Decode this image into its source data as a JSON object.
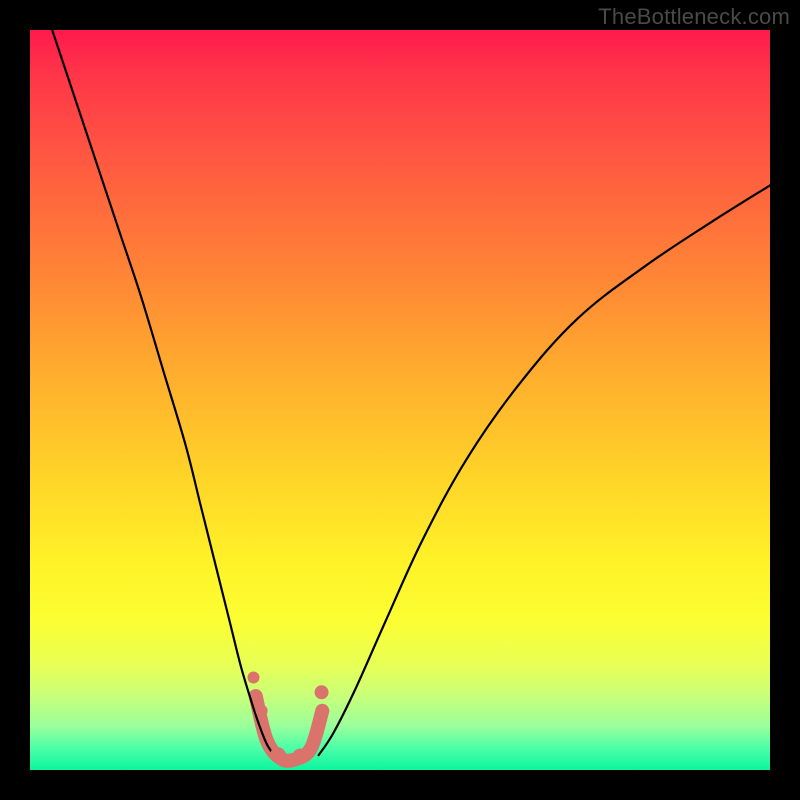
{
  "watermark": {
    "text": "TheBottleneck.com"
  },
  "chart_data": {
    "type": "line",
    "title": "",
    "xlabel": "",
    "ylabel": "",
    "xlim": [
      0,
      100
    ],
    "ylim": [
      0,
      100
    ],
    "grid": false,
    "legend": false,
    "background_gradient": {
      "orientation": "vertical",
      "stops": [
        {
          "pos": 0.0,
          "color": "#ff1a4d"
        },
        {
          "pos": 0.18,
          "color": "#ff5a41"
        },
        {
          "pos": 0.46,
          "color": "#ffac2e"
        },
        {
          "pos": 0.72,
          "color": "#fff228"
        },
        {
          "pos": 0.9,
          "color": "#c8ff7a"
        },
        {
          "pos": 1.0,
          "color": "#0cf59f"
        }
      ]
    },
    "series": [
      {
        "name": "left-arm",
        "color": "#000000",
        "x": [
          3,
          6,
          9,
          12,
          15,
          18,
          21,
          23,
          25,
          27,
          28.5,
          30,
          31,
          32,
          33
        ],
        "y": [
          100,
          91,
          82,
          73,
          64,
          54,
          44,
          36,
          28,
          20,
          14,
          9,
          6,
          3.5,
          2
        ]
      },
      {
        "name": "right-arm",
        "color": "#000000",
        "x": [
          39,
          41,
          44,
          48,
          53,
          59,
          66,
          74,
          83,
          92,
          100
        ],
        "y": [
          2,
          5,
          11,
          20,
          31,
          42,
          52,
          61,
          68,
          74,
          79
        ]
      },
      {
        "name": "valley-floor-marker",
        "color": "#d9736b",
        "stroke_width": 14,
        "x": [
          30.5,
          32,
          34,
          36,
          38,
          39.5
        ],
        "y": [
          10,
          4,
          1.5,
          1.5,
          3,
          8
        ]
      }
    ],
    "markers": [
      {
        "x": 30.2,
        "y": 12.5,
        "r": 6,
        "color": "#d9736b"
      },
      {
        "x": 31.3,
        "y": 8.0,
        "r": 6,
        "color": "#d9736b"
      },
      {
        "x": 33.5,
        "y": 2.0,
        "r": 8,
        "color": "#d9736b"
      },
      {
        "x": 36.5,
        "y": 1.8,
        "r": 8,
        "color": "#d9736b"
      },
      {
        "x": 39.4,
        "y": 10.5,
        "r": 7,
        "color": "#d9736b"
      }
    ]
  }
}
